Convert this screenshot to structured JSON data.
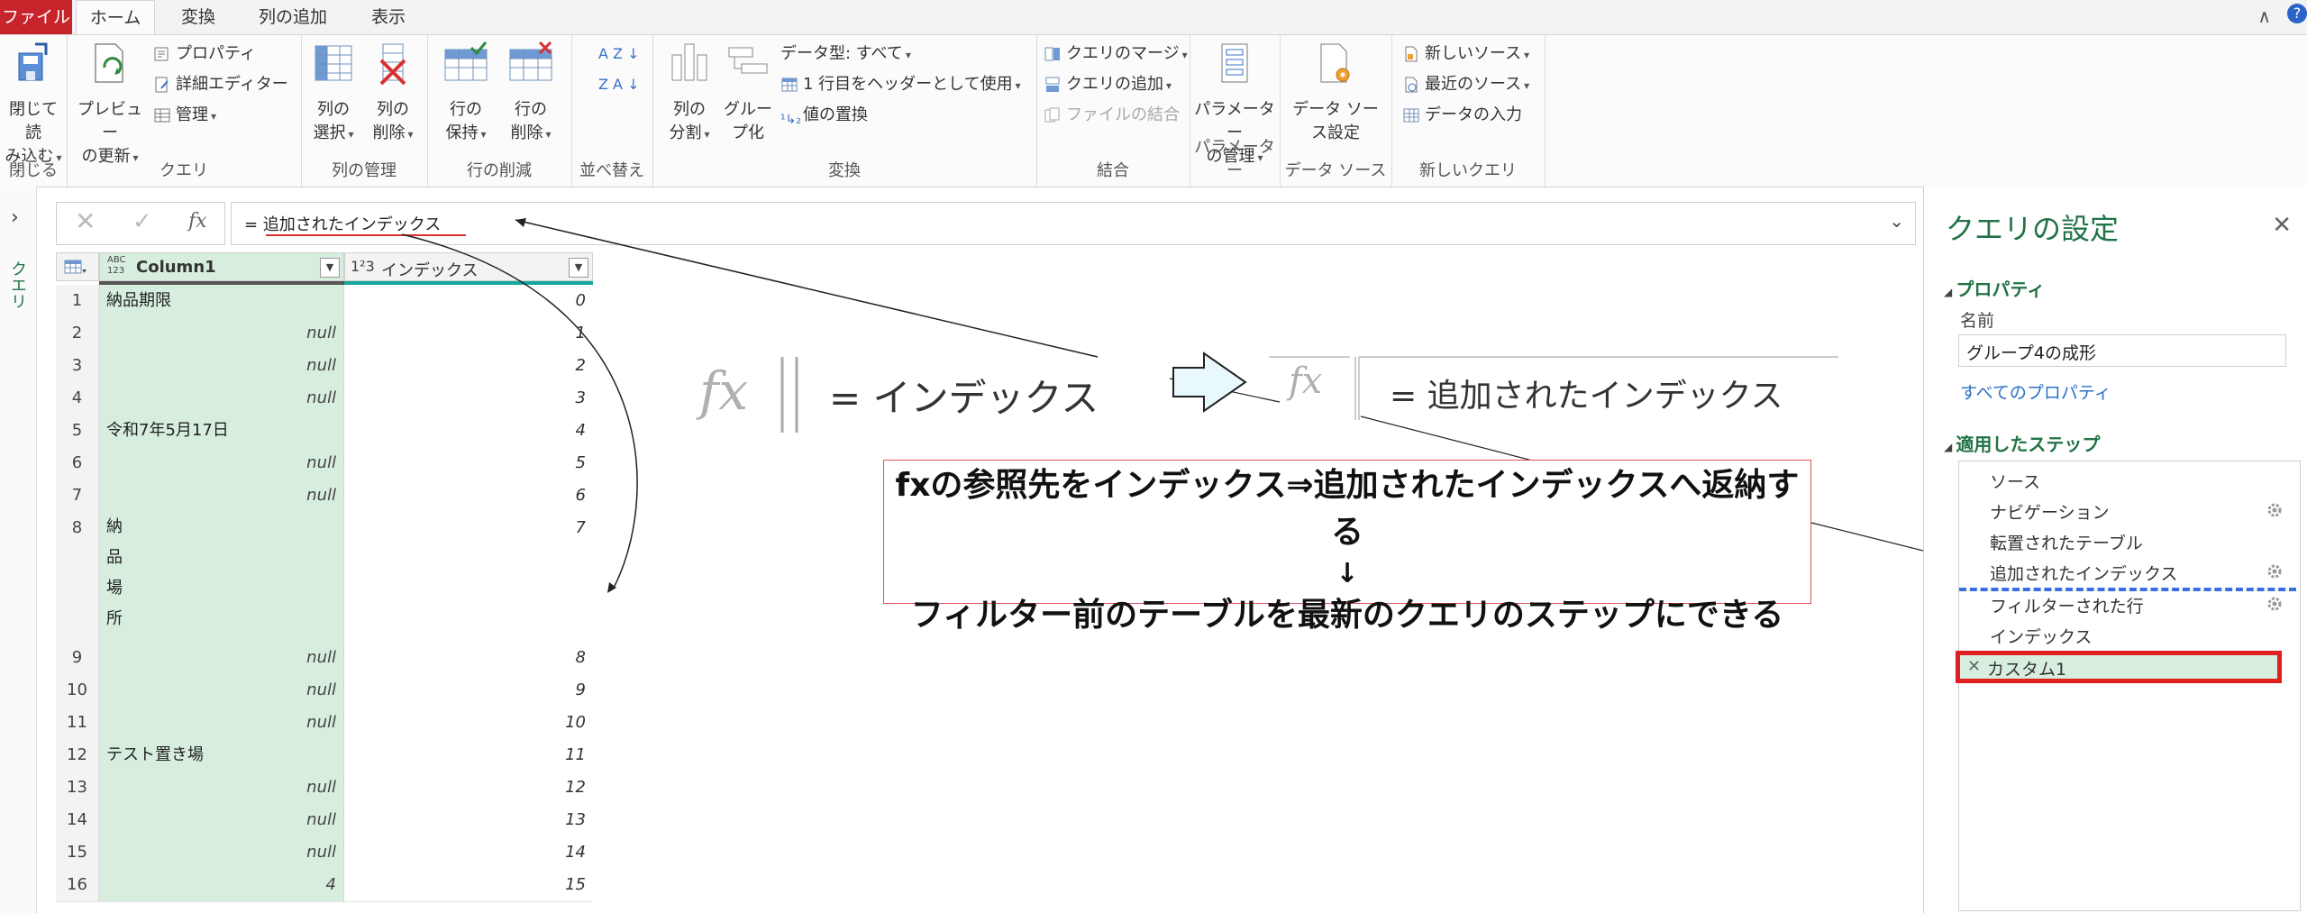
{
  "tabs": [
    {
      "label": "ファイル"
    },
    {
      "label": "ホーム"
    },
    {
      "label": "変換"
    },
    {
      "label": "列の追加"
    },
    {
      "label": "表示"
    }
  ],
  "ribbon": {
    "close": {
      "line1": "閉じて読",
      "line2": "み込む",
      "group": "閉じる"
    },
    "query": {
      "preview_line1": "プレビュー",
      "preview_line2": "の更新",
      "properties": "プロパティ",
      "advanced_editor": "詳細エディター",
      "manage": "管理",
      "group": "クエリ"
    },
    "columns": {
      "select_line1": "列の",
      "select_line2": "選択",
      "delete_line1": "列の",
      "delete_line2": "削除",
      "group": "列の管理"
    },
    "rows": {
      "keep_line1": "行の",
      "keep_line2": "保持",
      "remove_line1": "行の",
      "remove_line2": "削除",
      "group": "行の削減"
    },
    "sort": {
      "group": "並べ替え",
      "az": "A Z",
      "za": "Z A"
    },
    "transform": {
      "split_line1": "列の",
      "split_line2": "分割",
      "group_line1": "グルー",
      "group_line2": "プ化",
      "datatype": "データ型: すべて",
      "first_row_header": "1 行目をヘッダーとして使用",
      "replace_values": "値の置換",
      "group": "変換"
    },
    "combine": {
      "merge_queries": "クエリのマージ",
      "append_queries": "クエリの追加",
      "combine_files": "ファイルの結合",
      "group": "結合"
    },
    "params": {
      "line1": "パラメーター",
      "line2": "の管理",
      "group": "パラメーター"
    },
    "datasource": {
      "line1": "データ ソー",
      "line2": "ス設定",
      "group": "データ ソース"
    },
    "newquery": {
      "new_source": "新しいソース",
      "recent_sources": "最近のソース",
      "enter_data": "データの入力",
      "group": "新しいクエリ"
    }
  },
  "leftnav": {
    "queries_label": "クエリ"
  },
  "formula": {
    "text": "= 追加されたインデックス",
    "fx": "fx"
  },
  "grid": {
    "col1": {
      "type": "ABC\n123",
      "name": "Column1"
    },
    "col2": {
      "type": "1²3",
      "name": "インデックス"
    },
    "rows": [
      {
        "n": "1",
        "c1": "納品期限",
        "c2": "0"
      },
      {
        "n": "2",
        "c1": "null",
        "c2": "1"
      },
      {
        "n": "3",
        "c1": "null",
        "c2": "2"
      },
      {
        "n": "4",
        "c1": "null",
        "c2": "3"
      },
      {
        "n": "5",
        "c1": "令和7年5月17日",
        "c2": "4"
      },
      {
        "n": "6",
        "c1": "null",
        "c2": "5"
      },
      {
        "n": "7",
        "c1": "null",
        "c2": "6"
      },
      {
        "n": "8",
        "c1": "納",
        "c1b": "品",
        "c1c": "場",
        "c1d": "所",
        "c2": "7"
      },
      {
        "n": "9",
        "c1": "null",
        "c2": "8"
      },
      {
        "n": "10",
        "c1": "null",
        "c2": "9"
      },
      {
        "n": "11",
        "c1": "null",
        "c2": "10"
      },
      {
        "n": "12",
        "c1": "テスト置き場",
        "c2": "11"
      },
      {
        "n": "13",
        "c1": "null",
        "c2": "12"
      },
      {
        "n": "14",
        "c1": "null",
        "c2": "13"
      },
      {
        "n": "15",
        "c1": "null",
        "c2": "14"
      },
      {
        "n": "16",
        "c1": "4",
        "c2": "15"
      }
    ]
  },
  "annotation": {
    "before": {
      "fx": "fx",
      "text": "= インデックス"
    },
    "after": {
      "fx": "fx",
      "text": "= 追加されたインデックス"
    },
    "line1": "fxの参照先をインデックス⇒追加されたインデックスへ返納する",
    "line2": "↓",
    "line3": "フィルター前のテーブルを最新のクエリのステップにできる"
  },
  "settings": {
    "title": "クエリの設定",
    "properties_header": "プロパティ",
    "name_label": "名前",
    "name_value": "グループ4の成形",
    "all_properties": "すべてのプロパティ",
    "steps_header": "適用したステップ",
    "steps": [
      "ソース",
      "ナビゲーション",
      "転置されたテーブル",
      "追加されたインデックス",
      "フィルターされた行",
      "インデックス",
      "カスタム1"
    ]
  },
  "colors": {
    "accent": "#217346",
    "file_tab": "#c8242c",
    "grid_green": "#d7eedf",
    "highlight_red": "#e02020",
    "dash_blue": "#3b6fe0"
  }
}
